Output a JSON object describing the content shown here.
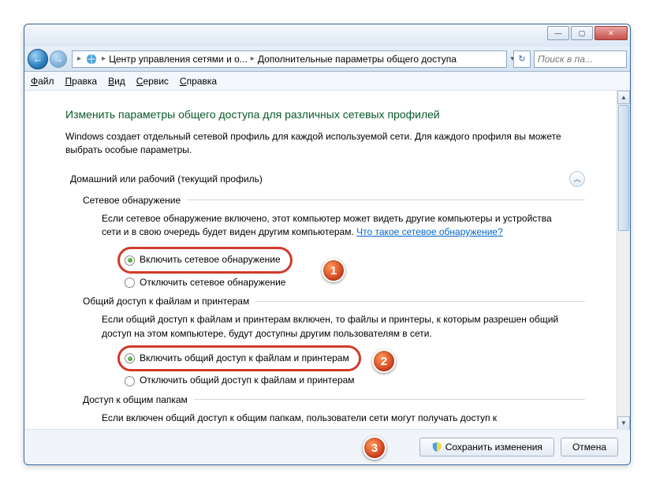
{
  "titlebar": {
    "min": "—",
    "max": "▢",
    "close": "✕"
  },
  "addr": {
    "back": "←",
    "fwd": "→",
    "refresh": "↻",
    "search_placeholder": "Поиск в па...",
    "crumb1": "Центр управления сетями и о...",
    "crumb2": "Дополнительные параметры общего доступа"
  },
  "menu": {
    "file": "айл",
    "edit": "равка",
    "view": "ид",
    "tools": "ервис",
    "help": "правка",
    "file_u": "Ф",
    "edit_u": "П",
    "view_u": "В",
    "tools_u": "С",
    "help_u": "С"
  },
  "heading": "Изменить параметры общего доступа для различных сетевых профилей",
  "desc": "Windows создает отдельный сетевой профиль для каждой используемой сети. Для каждого профиля вы можете выбрать особые параметры.",
  "profile": "Домашний или рабочий (текущий профиль)",
  "sec1": {
    "title": "Сетевое обнаружение",
    "body": "Если сетевое обнаружение включено, этот компьютер может видеть другие компьютеры и устройства сети и в свою очередь будет виден другим компьютерам. ",
    "link": "Что такое сетевое обнаружение?",
    "r1": "Включить сетевое обнаружение",
    "r2": "Отключить сетевое обнаружение"
  },
  "sec2": {
    "title": "Общий доступ к файлам и принтерам",
    "body": "Если общий доступ к файлам и принтерам включен, то файлы и принтеры, к которым разрешен общий доступ на этом компьютере, будут доступны другим пользователям в сети.",
    "r1": "Включить общий доступ к файлам и принтерам",
    "r2": "Отключить общий доступ к файлам и принтерам"
  },
  "sec3": {
    "title": "Доступ к общим папкам",
    "body": "Если включен общий доступ к общим папкам, пользователи сети могут получать доступ к"
  },
  "footer": {
    "save": "Сохранить изменения",
    "cancel": "Отмена"
  },
  "callouts": {
    "c1": "1",
    "c2": "2",
    "c3": "3"
  }
}
